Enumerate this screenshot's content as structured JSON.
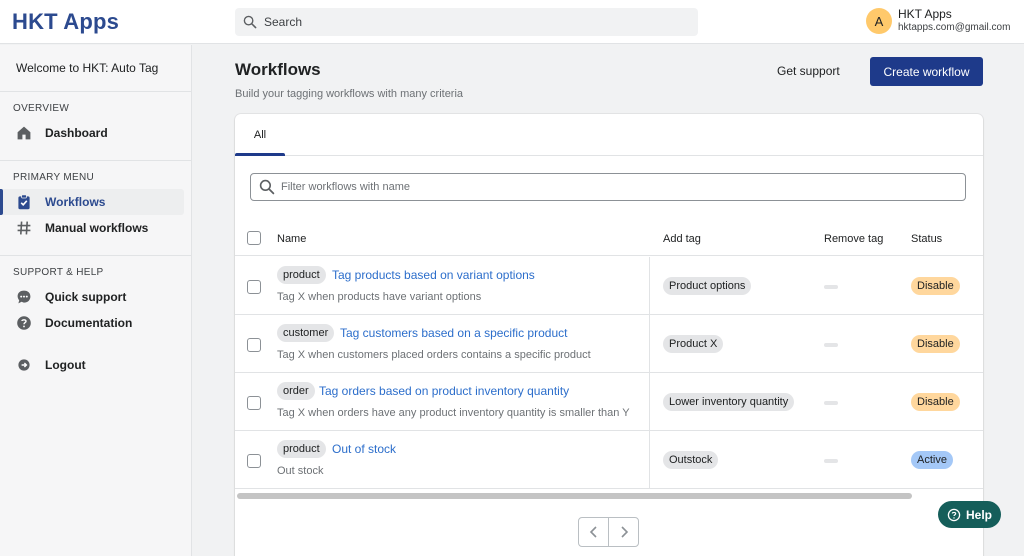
{
  "app": {
    "logo": "HKT Apps"
  },
  "search": {
    "placeholder": "Search"
  },
  "user": {
    "initial": "A",
    "name": "HKT Apps",
    "email": "hktapps.com@gmail.com"
  },
  "sidebar": {
    "welcome": "Welcome to HKT: Auto Tag",
    "sections": [
      {
        "title": "OVERVIEW",
        "items": [
          {
            "label": "Dashboard",
            "icon": "home-icon"
          }
        ]
      },
      {
        "title": "PRIMARY MENU",
        "items": [
          {
            "label": "Workflows",
            "icon": "clipboard-icon",
            "active": true
          },
          {
            "label": "Manual workflows",
            "icon": "hash-icon"
          }
        ]
      },
      {
        "title": "SUPPORT & HELP",
        "items": [
          {
            "label": "Quick support",
            "icon": "chat-icon"
          },
          {
            "label": "Documentation",
            "icon": "question-icon"
          },
          {
            "label": "Logout",
            "icon": "logout-icon"
          }
        ]
      }
    ]
  },
  "page": {
    "title": "Workflows",
    "subtitle": "Build your tagging workflows with many criteria",
    "get_support": "Get support",
    "create_button": "Create workflow"
  },
  "tabs": [
    {
      "label": "All",
      "active": true
    }
  ],
  "filter": {
    "placeholder": "Filter workflows with name"
  },
  "table": {
    "headers": {
      "name": "Name",
      "add_tag": "Add tag",
      "remove_tag": "Remove tag",
      "status": "Status"
    },
    "rows": [
      {
        "type": "product",
        "title": "Tag products based on variant options",
        "description": "Tag X when products have variant options",
        "add_tag": "Product options",
        "status": "Disable"
      },
      {
        "type": "customer",
        "title": "Tag customers based on a specific product",
        "description": "Tag X when customers placed orders contains a specific product",
        "add_tag": "Product X",
        "status": "Disable"
      },
      {
        "type": "order",
        "title": "Tag orders based on product inventory quantity",
        "description": "Tag X when orders have any product inventory quantity is smaller than Y",
        "add_tag": "Lower inventory quantity",
        "status": "Disable"
      },
      {
        "type": "product",
        "title": "Out of stock",
        "description": "Out stock",
        "add_tag": "Outstock",
        "status": "Active"
      }
    ]
  },
  "help": {
    "label": "Help"
  },
  "colors": {
    "brand": "#2c4a8f",
    "primary_button": "#1e3a8a",
    "link": "#2c6ecb",
    "disable_badge": "#ffd79d",
    "active_badge": "#a4c8f7",
    "help_button": "#155e5a"
  }
}
